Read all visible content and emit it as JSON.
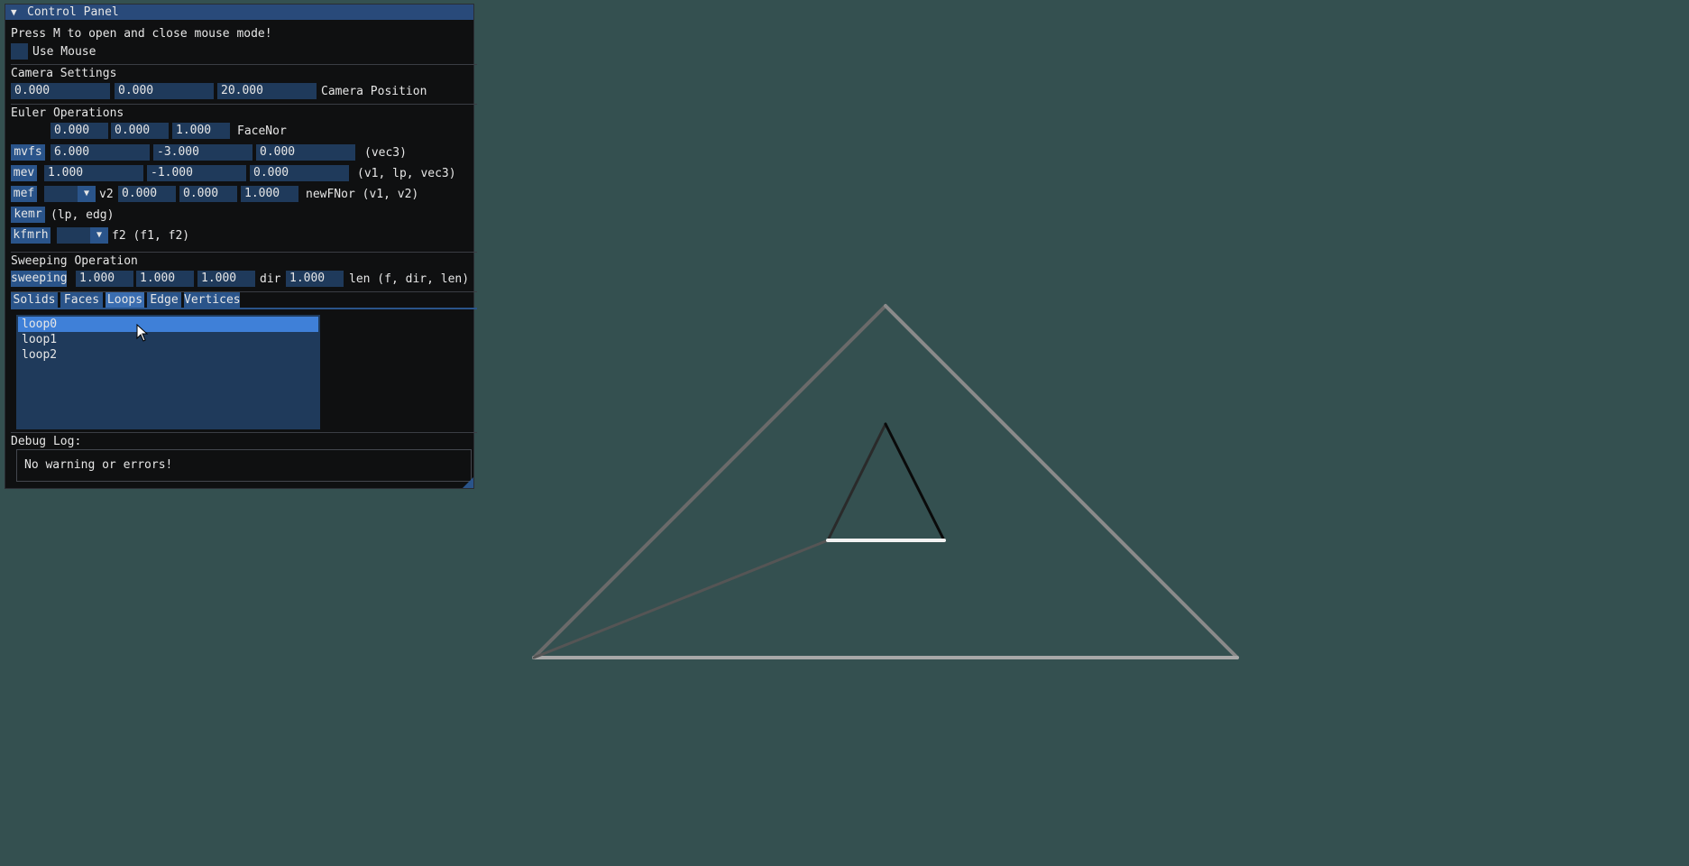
{
  "panel": {
    "title": "Control Panel",
    "mouse_hint": "Press M to open and close mouse mode!",
    "use_mouse_label": "Use Mouse",
    "use_mouse_checked": false
  },
  "camera": {
    "heading": "Camera Settings",
    "x": "0.000",
    "y": "0.000",
    "z": "20.000",
    "label": "Camera Position"
  },
  "euler": {
    "heading": "Euler Operations",
    "facenor": {
      "x": "0.000",
      "y": "0.000",
      "z": "1.000",
      "label": "FaceNor"
    },
    "mvfs": {
      "button": "mvfs",
      "x": "6.000",
      "y": "-3.000",
      "z": "0.000",
      "args": "(vec3)"
    },
    "mev": {
      "button": "mev",
      "v1": "1.000",
      "lp": "-1.000",
      "vec3": "0.000",
      "args": "(v1, lp, vec3)"
    },
    "mef": {
      "button": "mef",
      "combo_value": "",
      "v2_label": "v2",
      "x": "0.000",
      "y": "0.000",
      "z": "1.000",
      "args": "newFNor (v1, v2)"
    },
    "kemr": {
      "button": "kemr",
      "args": "(lp, edg)"
    },
    "kfmrh": {
      "button": "kfmrh",
      "combo_value": "",
      "args": "f2 (f1, f2)"
    }
  },
  "sweeping": {
    "heading": "Sweeping Operation",
    "button": "sweeping",
    "x": "1.000",
    "y": "1.000",
    "z": "1.000",
    "dir_label": "dir",
    "len": "1.000",
    "args": "len (f, dir, len)"
  },
  "tabs": [
    "Solids",
    "Faces",
    "Loops",
    "Edge",
    "Vertices"
  ],
  "active_tab": "Loops",
  "list": {
    "items": [
      "loop0",
      "loop1",
      "loop2"
    ],
    "selected": "loop0"
  },
  "debug": {
    "heading": "Debug Log:",
    "message": "No warning or errors!"
  },
  "colors": {
    "background": "#345050",
    "panel_bg": "#0f1011",
    "title_bg": "#294a7a",
    "field_bg": "#1f3a5b",
    "button_bg": "#2a548a",
    "selected_bg": "#3f80d8"
  }
}
